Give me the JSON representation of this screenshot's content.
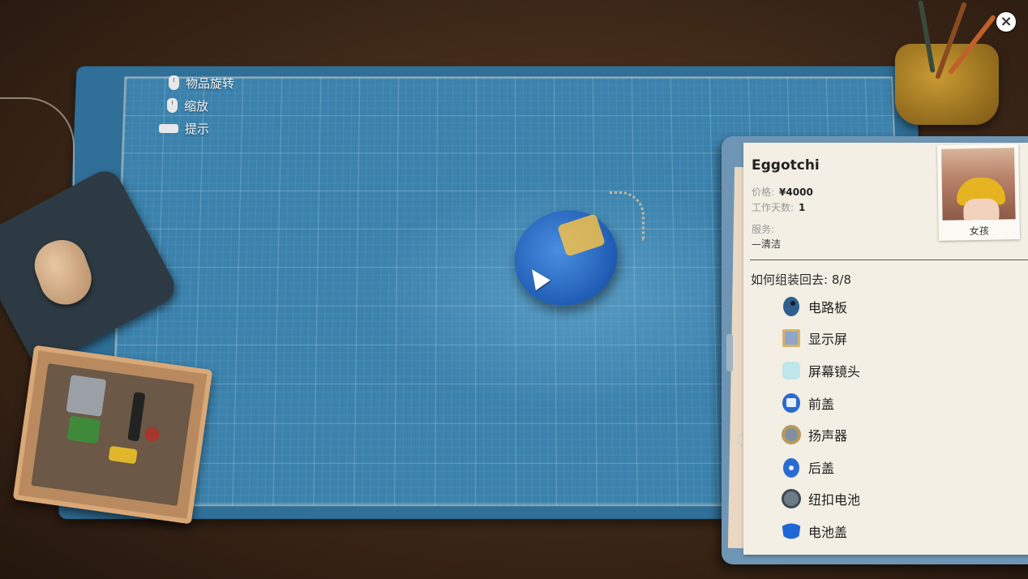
{
  "controls": [
    {
      "icon": "mouse-left-icon",
      "label": "物品旋转"
    },
    {
      "icon": "mouse-wheel-icon",
      "label": "缩放"
    },
    {
      "icon": "keyboard-key-icon",
      "label": "提示"
    }
  ],
  "close_label": "×",
  "order": {
    "title": "Eggotchi",
    "price_label": "价格:",
    "price": "¥4000",
    "days_label": "工作天数:",
    "days": "1",
    "service_label": "服务:",
    "service": "—清洁",
    "customer": "女孩"
  },
  "assembly": {
    "title": "如何组装回去:",
    "progress": "8/8",
    "parts": [
      {
        "icon": "circuit-board-icon",
        "label": "电路板",
        "color": "#2f5f8f"
      },
      {
        "icon": "display-screen-icon",
        "label": "显示屏",
        "color": "#8fa6c9"
      },
      {
        "icon": "screen-lens-icon",
        "label": "屏幕镜头",
        "color": "#bfe6ea"
      },
      {
        "icon": "front-cover-icon",
        "label": "前盖",
        "color": "#2a6bd1"
      },
      {
        "icon": "speaker-icon",
        "label": "扬声器",
        "color": "#b89a5a"
      },
      {
        "icon": "back-cover-icon",
        "label": "后盖",
        "color": "#2a6bd1"
      },
      {
        "icon": "button-battery-icon",
        "label": "纽扣电池",
        "color": "#6f7c88"
      },
      {
        "icon": "battery-cover-icon",
        "label": "电池盖",
        "color": "#1f66d6"
      }
    ]
  }
}
